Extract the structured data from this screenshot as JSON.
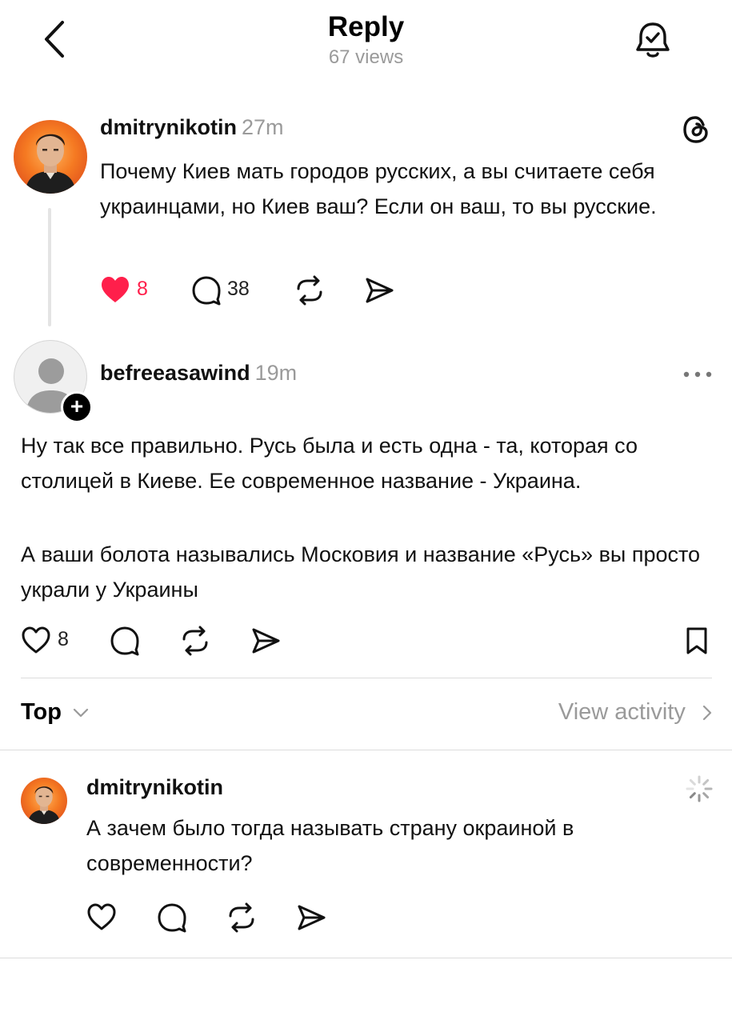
{
  "header": {
    "title": "Reply",
    "views": "67 views"
  },
  "original_post": {
    "username": "dmitrynikotin",
    "time": "27m",
    "text": "Почему Киев мать городов русских, а вы считаете себя украинцами, но Киев ваш? Если он ваш, то вы русские.",
    "likes": "8",
    "replies": "38",
    "liked": true
  },
  "reply_post": {
    "username": "befreeasawind",
    "time": "19m",
    "paragraph1": "Ну так все правильно. Русь была и есть одна - та, которая со столицей в Киеве. Ее современное название - Украина.",
    "paragraph2": "А ваши болота назывались Московия и название «Русь» вы просто украли у Украины",
    "likes": "8"
  },
  "sort": {
    "label": "Top",
    "view_activity": "View activity"
  },
  "composer": {
    "username": "dmitrynikotin",
    "text": "А зачем было тогда называть страну окраиной в современности?"
  },
  "colors": {
    "like_red": "#ff1f4b",
    "muted": "#9a9a9a"
  }
}
